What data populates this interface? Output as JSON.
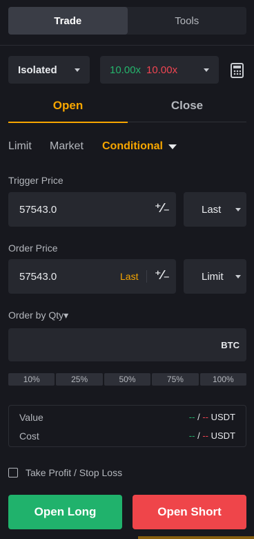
{
  "top_tabs": [
    {
      "label": "Trade",
      "active": true
    },
    {
      "label": "Tools",
      "active": false
    }
  ],
  "margin_mode": {
    "label": "Isolated"
  },
  "leverage": {
    "long": "10.00x",
    "short": "10.00x"
  },
  "order_side_tabs": [
    {
      "label": "Open",
      "active": true
    },
    {
      "label": "Close",
      "active": false
    }
  ],
  "order_types": [
    {
      "label": "Limit",
      "active": false
    },
    {
      "label": "Market",
      "active": false
    },
    {
      "label": "Conditional",
      "active": true
    }
  ],
  "trigger_price": {
    "label": "Trigger Price",
    "value": "57543.0",
    "type": "Last"
  },
  "order_price": {
    "label": "Order Price",
    "value": "57543.0",
    "tag": "Last",
    "type": "Limit"
  },
  "quantity": {
    "label": "Order by Qty▾",
    "value": "",
    "unit": "BTC"
  },
  "percent_options": [
    "10%",
    "25%",
    "50%",
    "75%",
    "100%"
  ],
  "info": [
    {
      "label": "Value",
      "long": "--",
      "sep": "/",
      "short": "--",
      "unit": "USDT"
    },
    {
      "label": "Cost",
      "long": "--",
      "sep": "/",
      "short": "--",
      "unit": "USDT"
    }
  ],
  "tp_sl": {
    "label": "Take Profit / Stop Loss",
    "checked": false
  },
  "buttons": {
    "long": "Open Long",
    "short": "Open Short"
  },
  "colors": {
    "accent": "#f7a600",
    "long": "#20b26c",
    "short": "#ef454a",
    "background": "#17181e"
  },
  "icons": [
    "chevron-down-icon",
    "calculator-icon",
    "percent-icon",
    "checkbox-icon"
  ]
}
